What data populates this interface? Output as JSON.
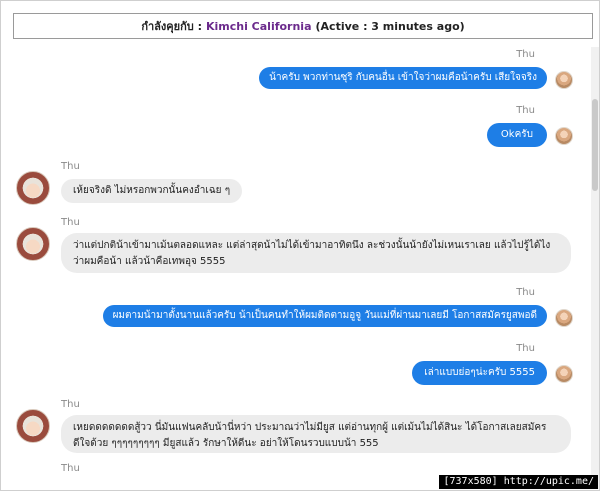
{
  "header": {
    "prefix": "กำลังคุยกับ :",
    "contact_name": "Kimchi California",
    "status": "(Active : 3 minutes ago)"
  },
  "messages": [
    {
      "side": "me",
      "sender": "Thu",
      "text": "น้าครับ พวกท่านซุริ กับคนอื่น เข้าใจว่าผมคือน้าครับ เสียใจจริง"
    },
    {
      "side": "me",
      "sender": "Thu",
      "text": "Okครับ"
    },
    {
      "side": "other",
      "sender": "Thu",
      "text": "เห้ยจริงดิ ไม่หรอกพวกนั้นคงอำเฉย ๆ"
    },
    {
      "side": "other",
      "sender": "Thu",
      "text": "ว่าแต่ปกติน้าเข้ามาเม้นตลอดแหละ แต่ล่าสุดน้าไม่ได้เข้ามาอาทิตนึง ละช่วงนั้นน้ายังไม่เหนเราเลย แล้วไปรู้ได้ไง ว่าผมคือน้า แล้วน้าคือเทพอุจ 5555"
    },
    {
      "side": "me",
      "sender": "Thu",
      "text": "ผมตามน้ามาตั้งนานแล้วครับ น้าเป็นคนทำให้ผมติดตามอูจู วันแม่ที่ผ่านมาเลยมี โอกาสสมัครยูสพอดี"
    },
    {
      "side": "me",
      "sender": "Thu",
      "text": "เล่าแบบย่อๆน่ะครับ 5555"
    },
    {
      "side": "other",
      "sender": "Thu",
      "text": "เหยดดดดดดดสู้วว นี่มันแฟนคลับน้านี่หว่า ประมาณว่าไม่มียูส แต่อ่านทุกผู้ แต่เม้นไม่ได้สินะ ได้โอกาสเลยสมัคร ดีใจด้วย ๆๆๆๆๆๆๆๆๆ มียูสแล้ว รักษาให้ดีนะ อย่าให้โดนรวบแบบน้า 555"
    },
    {
      "side": "other",
      "sender": "Thu",
      "text": ""
    }
  ],
  "watermark": "[737x580] http://upic.me/"
}
